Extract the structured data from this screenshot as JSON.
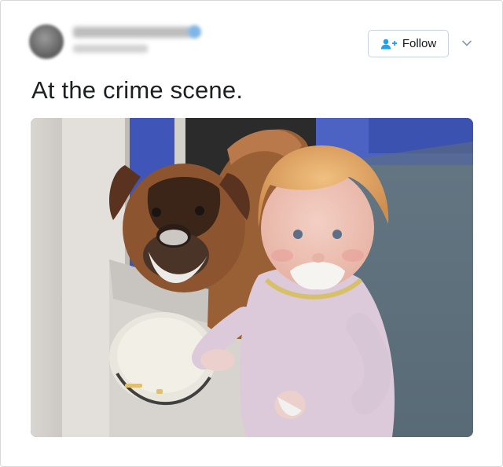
{
  "tweet": {
    "text": "At the crime scene.",
    "follow_label": "Follow",
    "icons": {
      "follow": "person-plus-icon",
      "menu": "chevron-down-icon",
      "verified": "verified-badge-icon"
    },
    "colors": {
      "accent": "#1da1f2",
      "text": "#1c2022",
      "border": "#c9d3dc"
    }
  }
}
